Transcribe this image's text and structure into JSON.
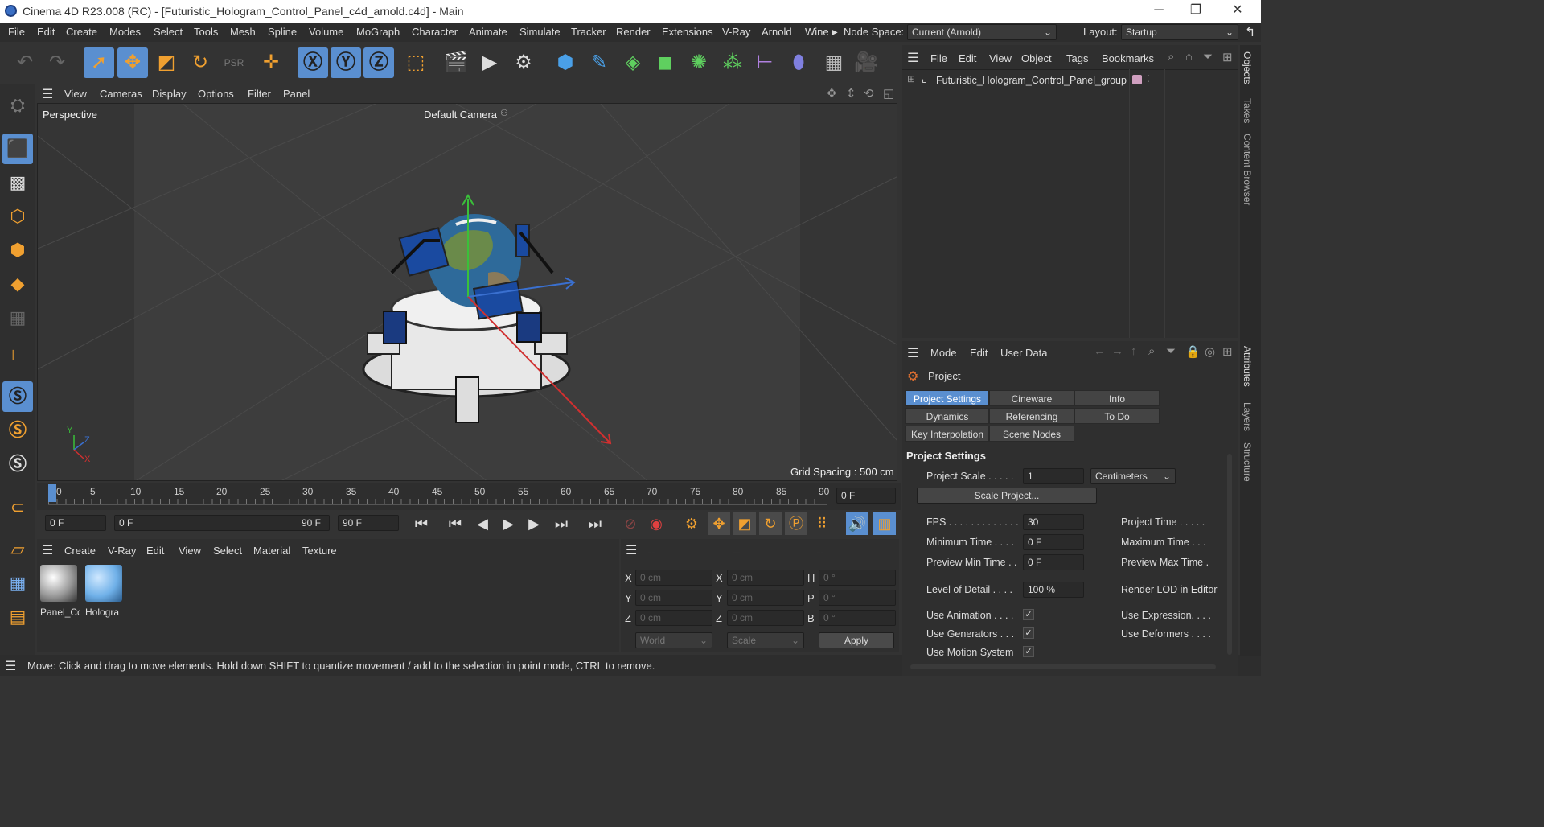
{
  "window": {
    "title": "Cinema 4D R23.008 (RC) - [Futuristic_Hologram_Control_Panel_c4d_arnold.c4d] - Main",
    "minimize": "─",
    "maximize": "❐",
    "close": "✕"
  },
  "menubar": {
    "items": [
      "File",
      "Edit",
      "Create",
      "Modes",
      "Select",
      "Tools",
      "Mesh",
      "Spline",
      "Volume",
      "MoGraph",
      "Character",
      "Animate",
      "Simulate",
      "Tracker",
      "Render",
      "Extensions",
      "V-Ray",
      "Arnold",
      "Wine"
    ],
    "node_space_label": "Node Space:",
    "node_space_value": "Current (Arnold)",
    "layout_label": "Layout:",
    "layout_value": "Startup"
  },
  "viewport": {
    "menu": [
      "View",
      "Cameras",
      "Display",
      "Options",
      "Filter",
      "Panel"
    ],
    "label": "Perspective",
    "camera": "Default Camera",
    "grid_spacing": "Grid Spacing : 500 cm",
    "axis_y": "Y",
    "axis_z": "Z",
    "axis_x": "X"
  },
  "timeline": {
    "ticks": [
      "0",
      "5",
      "10",
      "15",
      "20",
      "25",
      "30",
      "35",
      "40",
      "45",
      "50",
      "55",
      "60",
      "65",
      "70",
      "75",
      "80",
      "85",
      "90"
    ],
    "current_frame": "0 F"
  },
  "transport": {
    "start": "0 F",
    "range_start": "0 F",
    "range_end": "90 F",
    "end": "90 F"
  },
  "materials": {
    "menu": [
      "Create",
      "V-Ray",
      "Edit",
      "View",
      "Select",
      "Material",
      "Texture"
    ],
    "items": [
      {
        "name": "Panel_Co"
      },
      {
        "name": "Hologra"
      }
    ]
  },
  "coords": {
    "headers": [
      "--",
      "--",
      "--"
    ],
    "rows": [
      {
        "a": "X",
        "av": "0 cm",
        "b": "X",
        "bv": "0 cm",
        "c": "H",
        "cv": "0 °"
      },
      {
        "a": "Y",
        "av": "0 cm",
        "b": "Y",
        "bv": "0 cm",
        "c": "P",
        "cv": "0 °"
      },
      {
        "a": "Z",
        "av": "0 cm",
        "b": "Z",
        "bv": "0 cm",
        "c": "B",
        "cv": "0 °"
      }
    ],
    "world": "World",
    "scale": "Scale",
    "apply": "Apply"
  },
  "objects": {
    "menu": [
      "File",
      "Edit",
      "View",
      "Object",
      "Tags",
      "Bookmarks"
    ],
    "tree_item": "Futuristic_Hologram_Control_Panel_group"
  },
  "attributes": {
    "menu": [
      "Mode",
      "Edit",
      "User Data"
    ],
    "title": "Project",
    "tabs": [
      [
        "Project Settings",
        "Cineware",
        "Info"
      ],
      [
        "Dynamics",
        "Referencing",
        "To Do"
      ],
      [
        "Key Interpolation",
        "Scene Nodes"
      ]
    ],
    "section": "Project Settings",
    "project_scale_label": "Project Scale . . . . .",
    "project_scale_value": "1",
    "project_scale_unit": "Centimeters",
    "scale_project": "Scale Project...",
    "fps_label": "FPS . . . . . . . . . . . . .",
    "fps_value": "30",
    "min_time_label": "Minimum Time . . . .",
    "min_time_value": "0 F",
    "prev_min_label": "Preview Min Time . .",
    "prev_min_value": "0 F",
    "lod_label": "Level of Detail . . . .",
    "lod_value": "100 %",
    "project_time_label": "Project Time . . . . .",
    "max_time_label": "Maximum Time . . .",
    "prev_max_label": "Preview Max Time .",
    "render_lod_label": "Render LOD in Editor",
    "use_animation": "Use Animation . . . .",
    "use_generators": "Use Generators . . .",
    "use_motion": "Use Motion System",
    "use_expression": "Use Expression. . . .",
    "use_deformers": "Use Deformers . . . ."
  },
  "side_tabs": [
    "Objects",
    "Takes",
    "Content Browser",
    "Attributes",
    "Layers",
    "Structure"
  ],
  "status": "Move: Click and drag to move elements. Hold down SHIFT to quantize movement / add to the selection in point mode, CTRL to remove."
}
